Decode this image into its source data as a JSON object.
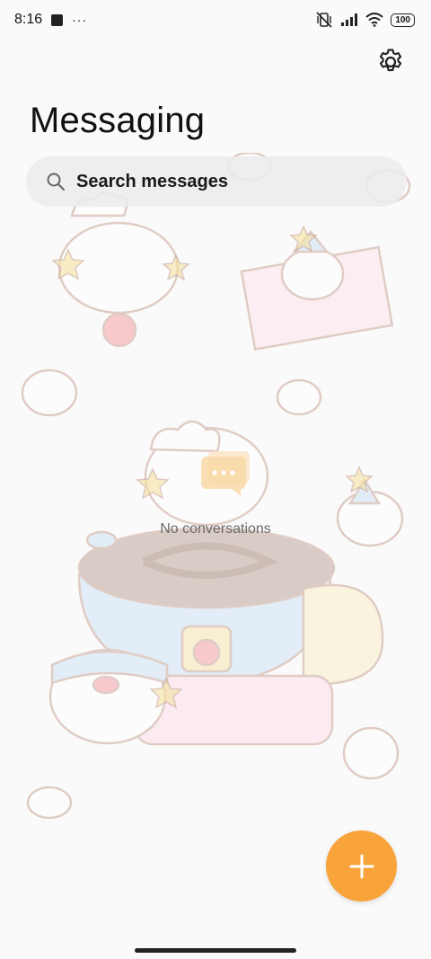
{
  "status_bar": {
    "time": "8:16",
    "dots": "···",
    "battery": "100"
  },
  "header": {
    "title": "Messaging",
    "settings_icon": "gear-icon"
  },
  "search": {
    "label": "Search messages",
    "icon": "search-icon"
  },
  "empty_state": {
    "text": "No conversations",
    "icon": "chat-bubble-icon"
  },
  "fab": {
    "icon": "plus-icon",
    "color": "#f9a43a"
  },
  "colors": {
    "background": "#fbfafa",
    "accent": "#f9a43a"
  }
}
